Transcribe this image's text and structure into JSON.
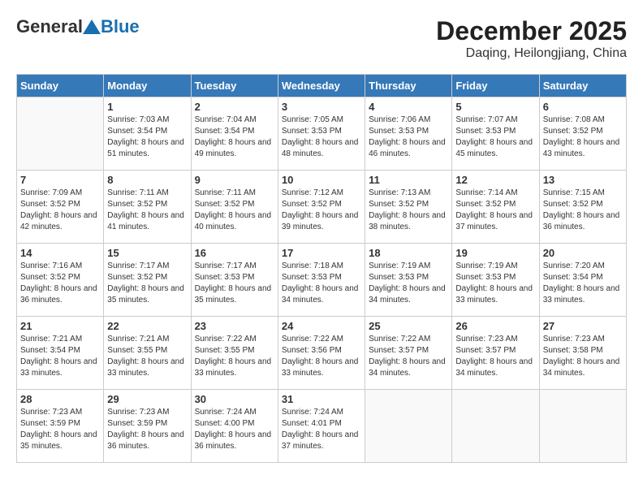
{
  "header": {
    "logo_general": "General",
    "logo_blue": "Blue",
    "month": "December 2025",
    "location": "Daqing, Heilongjiang, China"
  },
  "weekdays": [
    "Sunday",
    "Monday",
    "Tuesday",
    "Wednesday",
    "Thursday",
    "Friday",
    "Saturday"
  ],
  "weeks": [
    [
      {
        "day": "",
        "sunrise": "",
        "sunset": "",
        "daylight": ""
      },
      {
        "day": "1",
        "sunrise": "Sunrise: 7:03 AM",
        "sunset": "Sunset: 3:54 PM",
        "daylight": "Daylight: 8 hours and 51 minutes."
      },
      {
        "day": "2",
        "sunrise": "Sunrise: 7:04 AM",
        "sunset": "Sunset: 3:54 PM",
        "daylight": "Daylight: 8 hours and 49 minutes."
      },
      {
        "day": "3",
        "sunrise": "Sunrise: 7:05 AM",
        "sunset": "Sunset: 3:53 PM",
        "daylight": "Daylight: 8 hours and 48 minutes."
      },
      {
        "day": "4",
        "sunrise": "Sunrise: 7:06 AM",
        "sunset": "Sunset: 3:53 PM",
        "daylight": "Daylight: 8 hours and 46 minutes."
      },
      {
        "day": "5",
        "sunrise": "Sunrise: 7:07 AM",
        "sunset": "Sunset: 3:53 PM",
        "daylight": "Daylight: 8 hours and 45 minutes."
      },
      {
        "day": "6",
        "sunrise": "Sunrise: 7:08 AM",
        "sunset": "Sunset: 3:52 PM",
        "daylight": "Daylight: 8 hours and 43 minutes."
      }
    ],
    [
      {
        "day": "7",
        "sunrise": "Sunrise: 7:09 AM",
        "sunset": "Sunset: 3:52 PM",
        "daylight": "Daylight: 8 hours and 42 minutes."
      },
      {
        "day": "8",
        "sunrise": "Sunrise: 7:11 AM",
        "sunset": "Sunset: 3:52 PM",
        "daylight": "Daylight: 8 hours and 41 minutes."
      },
      {
        "day": "9",
        "sunrise": "Sunrise: 7:11 AM",
        "sunset": "Sunset: 3:52 PM",
        "daylight": "Daylight: 8 hours and 40 minutes."
      },
      {
        "day": "10",
        "sunrise": "Sunrise: 7:12 AM",
        "sunset": "Sunset: 3:52 PM",
        "daylight": "Daylight: 8 hours and 39 minutes."
      },
      {
        "day": "11",
        "sunrise": "Sunrise: 7:13 AM",
        "sunset": "Sunset: 3:52 PM",
        "daylight": "Daylight: 8 hours and 38 minutes."
      },
      {
        "day": "12",
        "sunrise": "Sunrise: 7:14 AM",
        "sunset": "Sunset: 3:52 PM",
        "daylight": "Daylight: 8 hours and 37 minutes."
      },
      {
        "day": "13",
        "sunrise": "Sunrise: 7:15 AM",
        "sunset": "Sunset: 3:52 PM",
        "daylight": "Daylight: 8 hours and 36 minutes."
      }
    ],
    [
      {
        "day": "14",
        "sunrise": "Sunrise: 7:16 AM",
        "sunset": "Sunset: 3:52 PM",
        "daylight": "Daylight: 8 hours and 36 minutes."
      },
      {
        "day": "15",
        "sunrise": "Sunrise: 7:17 AM",
        "sunset": "Sunset: 3:52 PM",
        "daylight": "Daylight: 8 hours and 35 minutes."
      },
      {
        "day": "16",
        "sunrise": "Sunrise: 7:17 AM",
        "sunset": "Sunset: 3:53 PM",
        "daylight": "Daylight: 8 hours and 35 minutes."
      },
      {
        "day": "17",
        "sunrise": "Sunrise: 7:18 AM",
        "sunset": "Sunset: 3:53 PM",
        "daylight": "Daylight: 8 hours and 34 minutes."
      },
      {
        "day": "18",
        "sunrise": "Sunrise: 7:19 AM",
        "sunset": "Sunset: 3:53 PM",
        "daylight": "Daylight: 8 hours and 34 minutes."
      },
      {
        "day": "19",
        "sunrise": "Sunrise: 7:19 AM",
        "sunset": "Sunset: 3:53 PM",
        "daylight": "Daylight: 8 hours and 33 minutes."
      },
      {
        "day": "20",
        "sunrise": "Sunrise: 7:20 AM",
        "sunset": "Sunset: 3:54 PM",
        "daylight": "Daylight: 8 hours and 33 minutes."
      }
    ],
    [
      {
        "day": "21",
        "sunrise": "Sunrise: 7:21 AM",
        "sunset": "Sunset: 3:54 PM",
        "daylight": "Daylight: 8 hours and 33 minutes."
      },
      {
        "day": "22",
        "sunrise": "Sunrise: 7:21 AM",
        "sunset": "Sunset: 3:55 PM",
        "daylight": "Daylight: 8 hours and 33 minutes."
      },
      {
        "day": "23",
        "sunrise": "Sunrise: 7:22 AM",
        "sunset": "Sunset: 3:55 PM",
        "daylight": "Daylight: 8 hours and 33 minutes."
      },
      {
        "day": "24",
        "sunrise": "Sunrise: 7:22 AM",
        "sunset": "Sunset: 3:56 PM",
        "daylight": "Daylight: 8 hours and 33 minutes."
      },
      {
        "day": "25",
        "sunrise": "Sunrise: 7:22 AM",
        "sunset": "Sunset: 3:57 PM",
        "daylight": "Daylight: 8 hours and 34 minutes."
      },
      {
        "day": "26",
        "sunrise": "Sunrise: 7:23 AM",
        "sunset": "Sunset: 3:57 PM",
        "daylight": "Daylight: 8 hours and 34 minutes."
      },
      {
        "day": "27",
        "sunrise": "Sunrise: 7:23 AM",
        "sunset": "Sunset: 3:58 PM",
        "daylight": "Daylight: 8 hours and 34 minutes."
      }
    ],
    [
      {
        "day": "28",
        "sunrise": "Sunrise: 7:23 AM",
        "sunset": "Sunset: 3:59 PM",
        "daylight": "Daylight: 8 hours and 35 minutes."
      },
      {
        "day": "29",
        "sunrise": "Sunrise: 7:23 AM",
        "sunset": "Sunset: 3:59 PM",
        "daylight": "Daylight: 8 hours and 36 minutes."
      },
      {
        "day": "30",
        "sunrise": "Sunrise: 7:24 AM",
        "sunset": "Sunset: 4:00 PM",
        "daylight": "Daylight: 8 hours and 36 minutes."
      },
      {
        "day": "31",
        "sunrise": "Sunrise: 7:24 AM",
        "sunset": "Sunset: 4:01 PM",
        "daylight": "Daylight: 8 hours and 37 minutes."
      },
      {
        "day": "",
        "sunrise": "",
        "sunset": "",
        "daylight": ""
      },
      {
        "day": "",
        "sunrise": "",
        "sunset": "",
        "daylight": ""
      },
      {
        "day": "",
        "sunrise": "",
        "sunset": "",
        "daylight": ""
      }
    ]
  ]
}
